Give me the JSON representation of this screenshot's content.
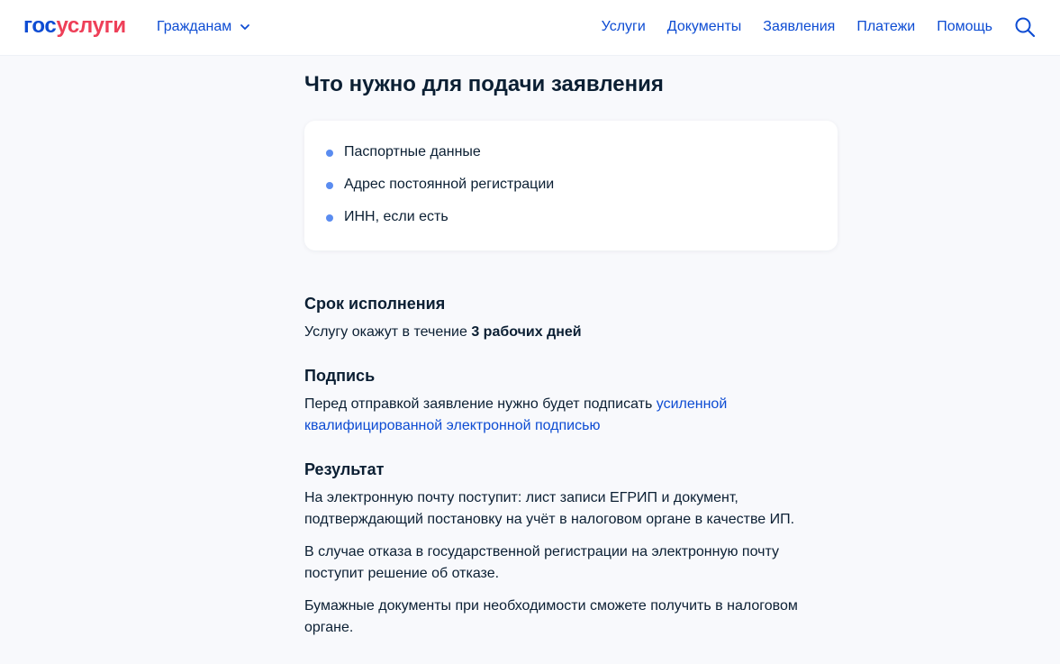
{
  "header": {
    "logo_part1": "гос",
    "logo_part2": "услуги",
    "audience": "Гражданам",
    "nav": [
      "Услуги",
      "Документы",
      "Заявления",
      "Платежи",
      "Помощь"
    ]
  },
  "requirements": {
    "title": "Что нужно для подачи заявления",
    "items": [
      "Паспортные данные",
      "Адрес постоянной регистрации",
      "ИНН, если есть"
    ]
  },
  "deadline": {
    "title": "Срок исполнения",
    "text_prefix": "Услугу окажут в течение ",
    "text_bold": "3 рабочих дней"
  },
  "signature": {
    "title": "Подпись",
    "text_prefix": "Перед отправкой заявление нужно будет подписать ",
    "link": "усиленной квалифицированной электронной подписью"
  },
  "result": {
    "title": "Результат",
    "paragraphs": [
      "На электронную почту поступит: лист записи ЕГРИП и документ, подтверждающий постановку на учёт в налоговом органе в качестве ИП.",
      "В случае отказа в государственной регистрации на электронную почту поступит решение об отказе.",
      "Бумажные документы при необходимости сможете получить в налоговом органе."
    ]
  },
  "colors": {
    "accent": "#0d4cd3",
    "brand_red": "#ee3f58",
    "bullet": "#5a8cf0"
  },
  "icons": {
    "search": "search-icon",
    "audience_chevron": "chevron-down-icon"
  }
}
